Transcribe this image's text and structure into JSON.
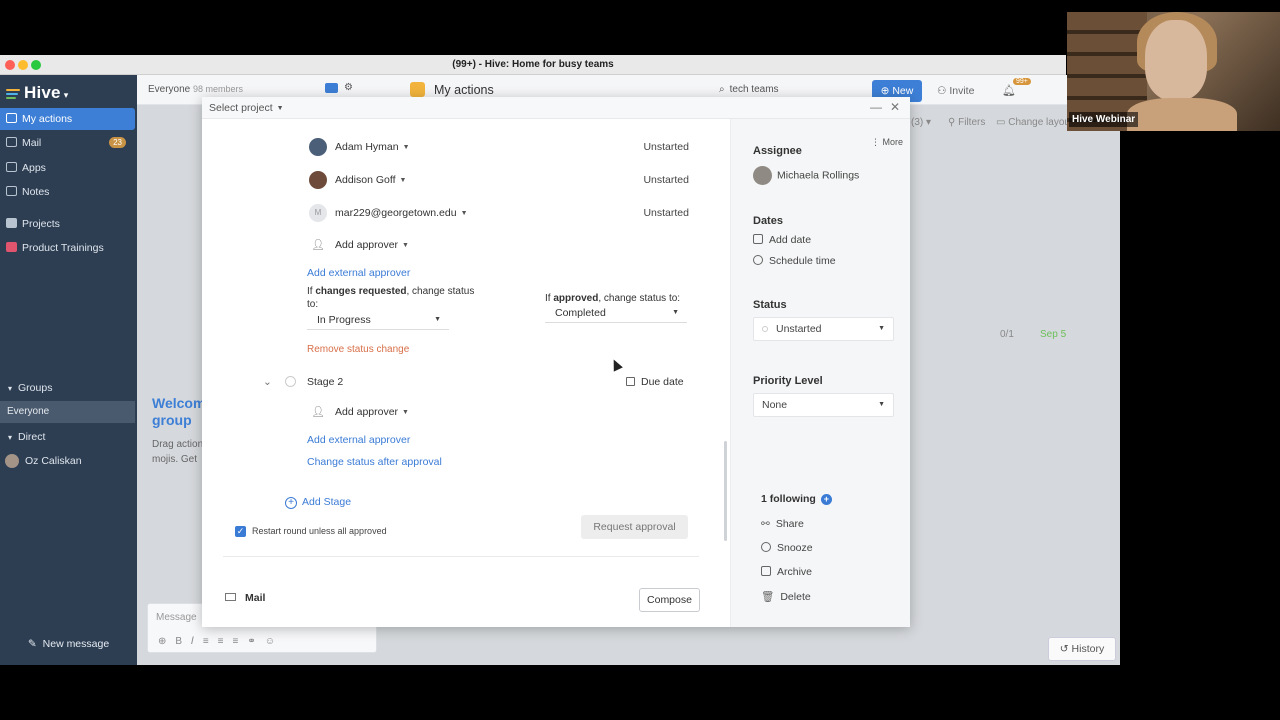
{
  "window": {
    "title": "(99+) - Hive: Home for busy teams"
  },
  "sidebar": {
    "logo": "Hive",
    "items": [
      {
        "label": "My actions"
      },
      {
        "label": "Mail",
        "badge": "23"
      },
      {
        "label": "Apps"
      },
      {
        "label": "Notes"
      },
      {
        "label": "Projects"
      },
      {
        "label": "Product Trainings"
      }
    ],
    "groups_label": "Groups",
    "everyone": "Everyone",
    "direct_label": "Direct",
    "direct_user": "Oz Caliskan",
    "new_message": "New message"
  },
  "background": {
    "everyone": "Everyone",
    "members": "98 members",
    "page_title": "My actions",
    "search": "tech teams",
    "new": "New",
    "invite": "Invite",
    "notif_badge": "99+",
    "filters": "Filters",
    "change_layout": "Change layou",
    "count": "(3)",
    "row_progress": "0/1",
    "row_date": "Sep 5",
    "welcome": "Welcom group",
    "welcome_sub1": "Drag action",
    "welcome_sub2": "mojis. Get",
    "message_placeholder": "Message",
    "history": "History"
  },
  "modal": {
    "select_project": "Select project",
    "approvers": [
      {
        "name": "Adam Hyman",
        "status": "Unstarted"
      },
      {
        "name": "Addison Goff",
        "status": "Unstarted"
      },
      {
        "name": "mar229@georgetown.edu",
        "status": "Unstarted",
        "initial": "M"
      }
    ],
    "add_approver": "Add approver",
    "add_external_approver": "Add external approver",
    "if_changes_prefix": "If ",
    "if_changes_bold": "changes requested",
    "if_changes_suffix": ", change status",
    "if_changes_to": "to:",
    "changes_status": "In Progress",
    "if_approved_prefix": "If ",
    "if_approved_bold": "approved",
    "if_approved_suffix": ", change status to:",
    "approved_status": "Completed",
    "remove_status_change": "Remove status change",
    "stage2": "Stage 2",
    "due_date": "Due date",
    "add_approver2": "Add approver",
    "add_external_approver2": "Add external approver",
    "change_status_after": "Change status after approval",
    "add_stage": "Add Stage",
    "restart_round": "Restart round unless all approved",
    "request_approval": "Request approval",
    "mail": "Mail",
    "compose": "Compose"
  },
  "details": {
    "more": "More",
    "assignee_label": "Assignee",
    "assignee": "Michaela Rollings",
    "dates_label": "Dates",
    "add_date": "Add date",
    "schedule_time": "Schedule time",
    "status_label": "Status",
    "status": "Unstarted",
    "priority_label": "Priority Level",
    "priority": "None",
    "following": "1 following",
    "share": "Share",
    "snooze": "Snooze",
    "archive": "Archive",
    "delete": "Delete"
  },
  "webcam": {
    "label": "Hive Webinar"
  },
  "colors": {
    "accent": "#3d7fd6",
    "sidebar": "#2d3e53",
    "warning": "#d8704a",
    "date_green": "#6cbf5a"
  }
}
